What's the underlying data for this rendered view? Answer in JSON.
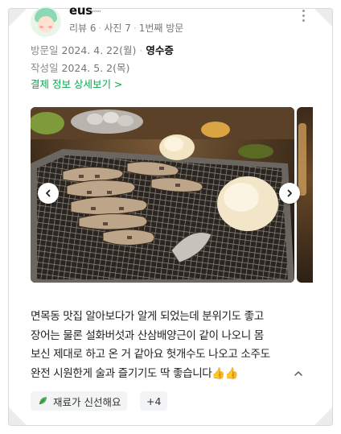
{
  "reviewer": {
    "nickname": "eus",
    "nickname_masked": "·······",
    "stats": {
      "reviews": "리뷰 6",
      "photos": "사진 7",
      "visit_count": "1번째 방문"
    }
  },
  "visit": {
    "visit_label": "방문일",
    "visit_date": "2024. 4. 22(월)",
    "receipt_label": "영수증",
    "written_label": "작성일",
    "written_date": "2024. 5. 2(목)",
    "payment_link": "결제 정보 상세보기 >"
  },
  "photo": {
    "alt": "장어 숯불구이 사진",
    "prev_icon": "chevron-left-icon",
    "next_icon": "chevron-right-icon"
  },
  "review": {
    "lines": [
      "면목동 맛집 알아보다가 알게 되었는데 분위기도 좋고",
      "장어는 물론 설화버섯과 산삼배양근이 같이 나오니 몸",
      "보신 제대로 하고 온 거 같아요 헛개수도 나오고 소주도",
      "완전 시원한게 술과 즐기기도 딱 좋습니다👍👍"
    ],
    "collapse_icon": "chevron-up-icon"
  },
  "tags": {
    "first": "재료가 신선해요",
    "more": "+4"
  },
  "colors": {
    "accent_green": "#03a94d",
    "text_gray": "#777777",
    "tag_bg": "#f3f4f5"
  }
}
